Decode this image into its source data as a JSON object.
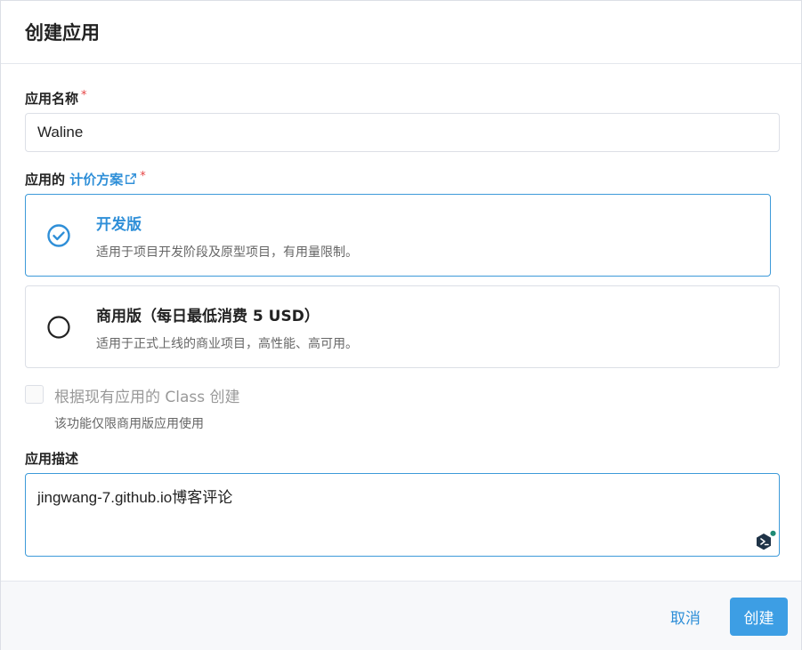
{
  "dialog": {
    "title": "创建应用"
  },
  "app_name": {
    "label": "应用名称",
    "required_mark": "*",
    "value": "Waline"
  },
  "pricing": {
    "label_prefix": "应用的",
    "label_link": "计价方案",
    "required_mark": "*",
    "plans": [
      {
        "name": "开发版",
        "description": "适用于项目开发阶段及原型项目，有用量限制。",
        "selected": true
      },
      {
        "name": "商用版（每日最低消费 5 USD）",
        "description": "适用于正式上线的商业项目，高性能、高可用。",
        "selected": false
      }
    ]
  },
  "clone_option": {
    "label": "根据现有应用的 Class 创建",
    "hint": "该功能仅限商用版应用使用",
    "checked": false,
    "disabled": true
  },
  "description": {
    "label": "应用描述",
    "value": "jingwang-7.github.io博客评论"
  },
  "footer": {
    "cancel_label": "取消",
    "create_label": "创建"
  },
  "colors": {
    "accent": "#2f8fd8",
    "primary_button": "#3d9ee4",
    "required": "#e64545"
  },
  "icons": {
    "selected_radio": "check-circle-icon",
    "unselected_radio": "empty-circle-icon",
    "external_link": "external-link-icon",
    "extension_badge": "extension-badge-icon"
  }
}
